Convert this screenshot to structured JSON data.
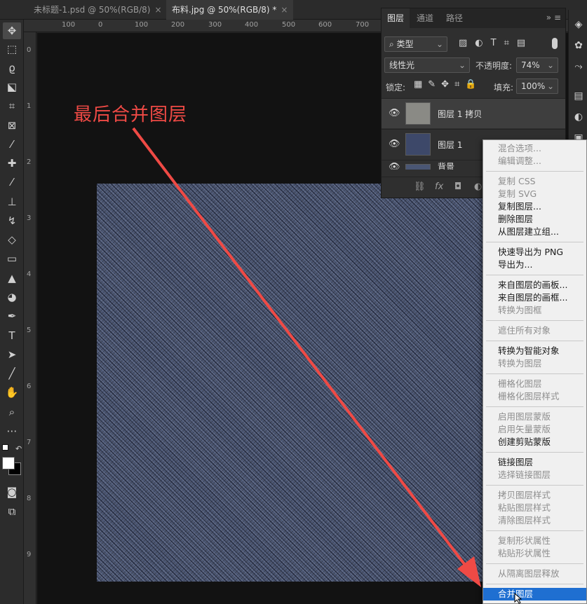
{
  "tabs": [
    {
      "label": "未标题-1.psd @ 50%(RGB/8)",
      "close": "×"
    },
    {
      "label": "布料.jpg @ 50%(RGB/8) *",
      "close": "×"
    }
  ],
  "ruler": {
    "h_ticks": [
      "100",
      "0",
      "100",
      "200",
      "300",
      "400",
      "500",
      "600",
      "700"
    ],
    "v_ticks": [
      "0",
      "1",
      "2",
      "3",
      "4",
      "5",
      "6",
      "7",
      "8",
      "9"
    ]
  },
  "annotation": "最后合并图层",
  "layers_panel": {
    "tabs": [
      "图层",
      "通道",
      "路径"
    ],
    "more": "»",
    "filter_kind": "类型",
    "blend_mode": "线性光",
    "opacity_label": "不透明度:",
    "opacity_value": "74%",
    "lock_label": "锁定:",
    "fill_label": "填充:",
    "fill_value": "100%",
    "layers": [
      {
        "name": "图层 1 拷贝",
        "selected": true
      },
      {
        "name": "图层 1",
        "selected": false
      },
      {
        "name": "背景",
        "selected": false
      }
    ]
  },
  "context_menu": {
    "groups": [
      [
        {
          "label": "混合选项...",
          "enabled": false
        },
        {
          "label": "编辑调整...",
          "enabled": false
        }
      ],
      [
        {
          "label": "复制 CSS",
          "enabled": false
        },
        {
          "label": "复制 SVG",
          "enabled": false
        },
        {
          "label": "复制图层...",
          "enabled": true
        },
        {
          "label": "删除图层",
          "enabled": true
        },
        {
          "label": "从图层建立组...",
          "enabled": true
        }
      ],
      [
        {
          "label": "快速导出为 PNG",
          "enabled": true
        },
        {
          "label": "导出为...",
          "enabled": true
        }
      ],
      [
        {
          "label": "来自图层的画板...",
          "enabled": true
        },
        {
          "label": "来自图层的画框...",
          "enabled": true
        },
        {
          "label": "转换为图框",
          "enabled": false
        }
      ],
      [
        {
          "label": "遮住所有对象",
          "enabled": false
        }
      ],
      [
        {
          "label": "转换为智能对象",
          "enabled": true
        },
        {
          "label": "转换为图层",
          "enabled": false
        }
      ],
      [
        {
          "label": "栅格化图层",
          "enabled": false
        },
        {
          "label": "栅格化图层样式",
          "enabled": false
        }
      ],
      [
        {
          "label": "启用图层蒙版",
          "enabled": false
        },
        {
          "label": "启用矢量蒙版",
          "enabled": false
        },
        {
          "label": "创建剪贴蒙版",
          "enabled": true
        }
      ],
      [
        {
          "label": "链接图层",
          "enabled": true
        },
        {
          "label": "选择链接图层",
          "enabled": false
        }
      ],
      [
        {
          "label": "拷贝图层样式",
          "enabled": false
        },
        {
          "label": "粘贴图层样式",
          "enabled": false
        },
        {
          "label": "清除图层样式",
          "enabled": false
        }
      ],
      [
        {
          "label": "复制形状属性",
          "enabled": false
        },
        {
          "label": "粘贴形状属性",
          "enabled": false
        }
      ],
      [
        {
          "label": "从隔离图层释放",
          "enabled": false
        }
      ],
      [
        {
          "label": "合并图层",
          "enabled": true,
          "highlighted": true
        }
      ]
    ]
  },
  "colors": {
    "annotation": "#ef4a45",
    "menu_highlight": "#1f6fd1",
    "denim": "#4a5674"
  }
}
